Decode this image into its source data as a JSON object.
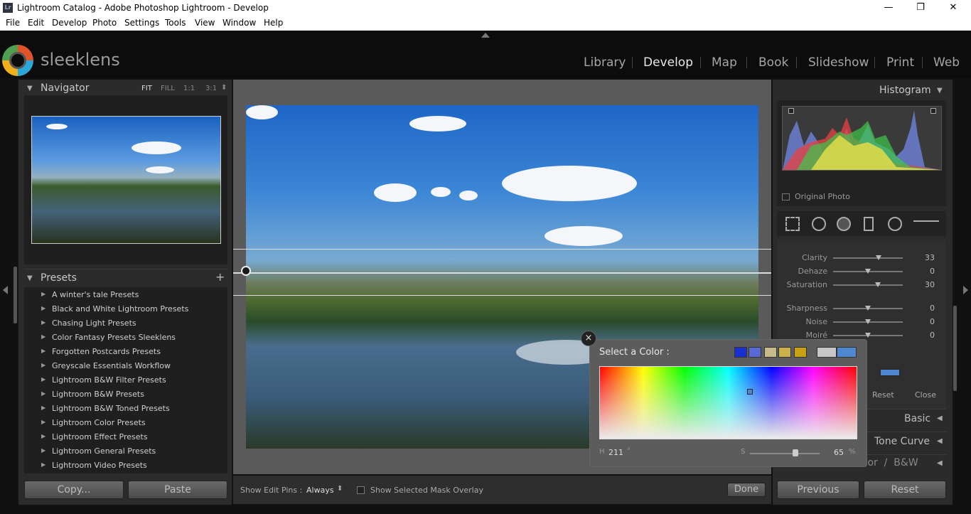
{
  "window": {
    "app_badge": "Lr",
    "title": "Lightroom Catalog - Adobe Photoshop Lightroom - Develop",
    "minimize": "—",
    "restore": "❐",
    "close": "✕"
  },
  "menu": [
    "File",
    "Edit",
    "Develop",
    "Photo",
    "Settings",
    "Tools",
    "View",
    "Window",
    "Help"
  ],
  "brand": {
    "logo_text": "sleeklens",
    "ring_colors": [
      "#e0542a",
      "#2ca7d9",
      "#f1b01b",
      "#4fa04e"
    ]
  },
  "modules": [
    "Library",
    "Develop",
    "Map",
    "Book",
    "Slideshow",
    "Print",
    "Web"
  ],
  "active_module": "Develop",
  "navigator": {
    "title": "Navigator",
    "zoom": [
      "FIT",
      "FILL",
      "1:1",
      "3:1"
    ],
    "zoom_arrow": "⬍"
  },
  "presets": {
    "title": "Presets",
    "add": "+",
    "items": [
      "A winter's tale Presets",
      "Black and White Lightroom Presets",
      "Chasing Light Presets",
      "Color Fantasy Presets Sleeklens",
      "Forgotten Postcards Presets",
      "Greyscale Essentials Workflow",
      "Lightroom B&W Filter Presets",
      "Lightroom B&W Presets",
      "Lightroom B&W Toned Presets",
      "Lightroom Color Presets",
      "Lightroom Effect Presets",
      "Lightroom General Presets",
      "Lightroom Video Presets"
    ]
  },
  "left_buttons": {
    "copy": "Copy...",
    "paste": "Paste"
  },
  "toolbar": {
    "show_edit_pins_label": "Show Edit Pins :",
    "show_edit_pins_value": "Always",
    "overlay_label": "Show Selected Mask Overlay",
    "done": "Done"
  },
  "histogram": {
    "title": "Histogram",
    "original_photo": "Original Photo"
  },
  "adjust": {
    "sliders": [
      {
        "label": "Clarity",
        "value": "33",
        "pos": 0.65
      },
      {
        "label": "Dehaze",
        "value": "0",
        "pos": 0.5
      },
      {
        "label": "Saturation",
        "value": "30",
        "pos": 0.64
      },
      {
        "label": "Sharpness",
        "value": "0",
        "pos": 0.5
      },
      {
        "label": "Noise",
        "value": "0",
        "pos": 0.5
      },
      {
        "label": "Moiré",
        "value": "0",
        "pos": 0.5
      }
    ],
    "reset": "Reset",
    "close": "Close"
  },
  "sections": {
    "basic": "Basic",
    "tone_curve": "Tone Curve",
    "color_bw": "olor  /  B&W"
  },
  "right_buttons": {
    "previous": "Previous",
    "reset": "Reset"
  },
  "color_picker": {
    "title": "Select a Color :",
    "close": "×",
    "swatches": [
      "#1a2fd0",
      "#5a6ad4",
      "#c8bb8a",
      "#c9b04a",
      "#c8a010",
      "#c7c7c7",
      "#4f88d0"
    ],
    "h_label": "H",
    "h_value": "211",
    "h_unit": "°",
    "s_label": "S",
    "s_value": "65",
    "s_unit": "%",
    "s_fraction": 0.65
  }
}
